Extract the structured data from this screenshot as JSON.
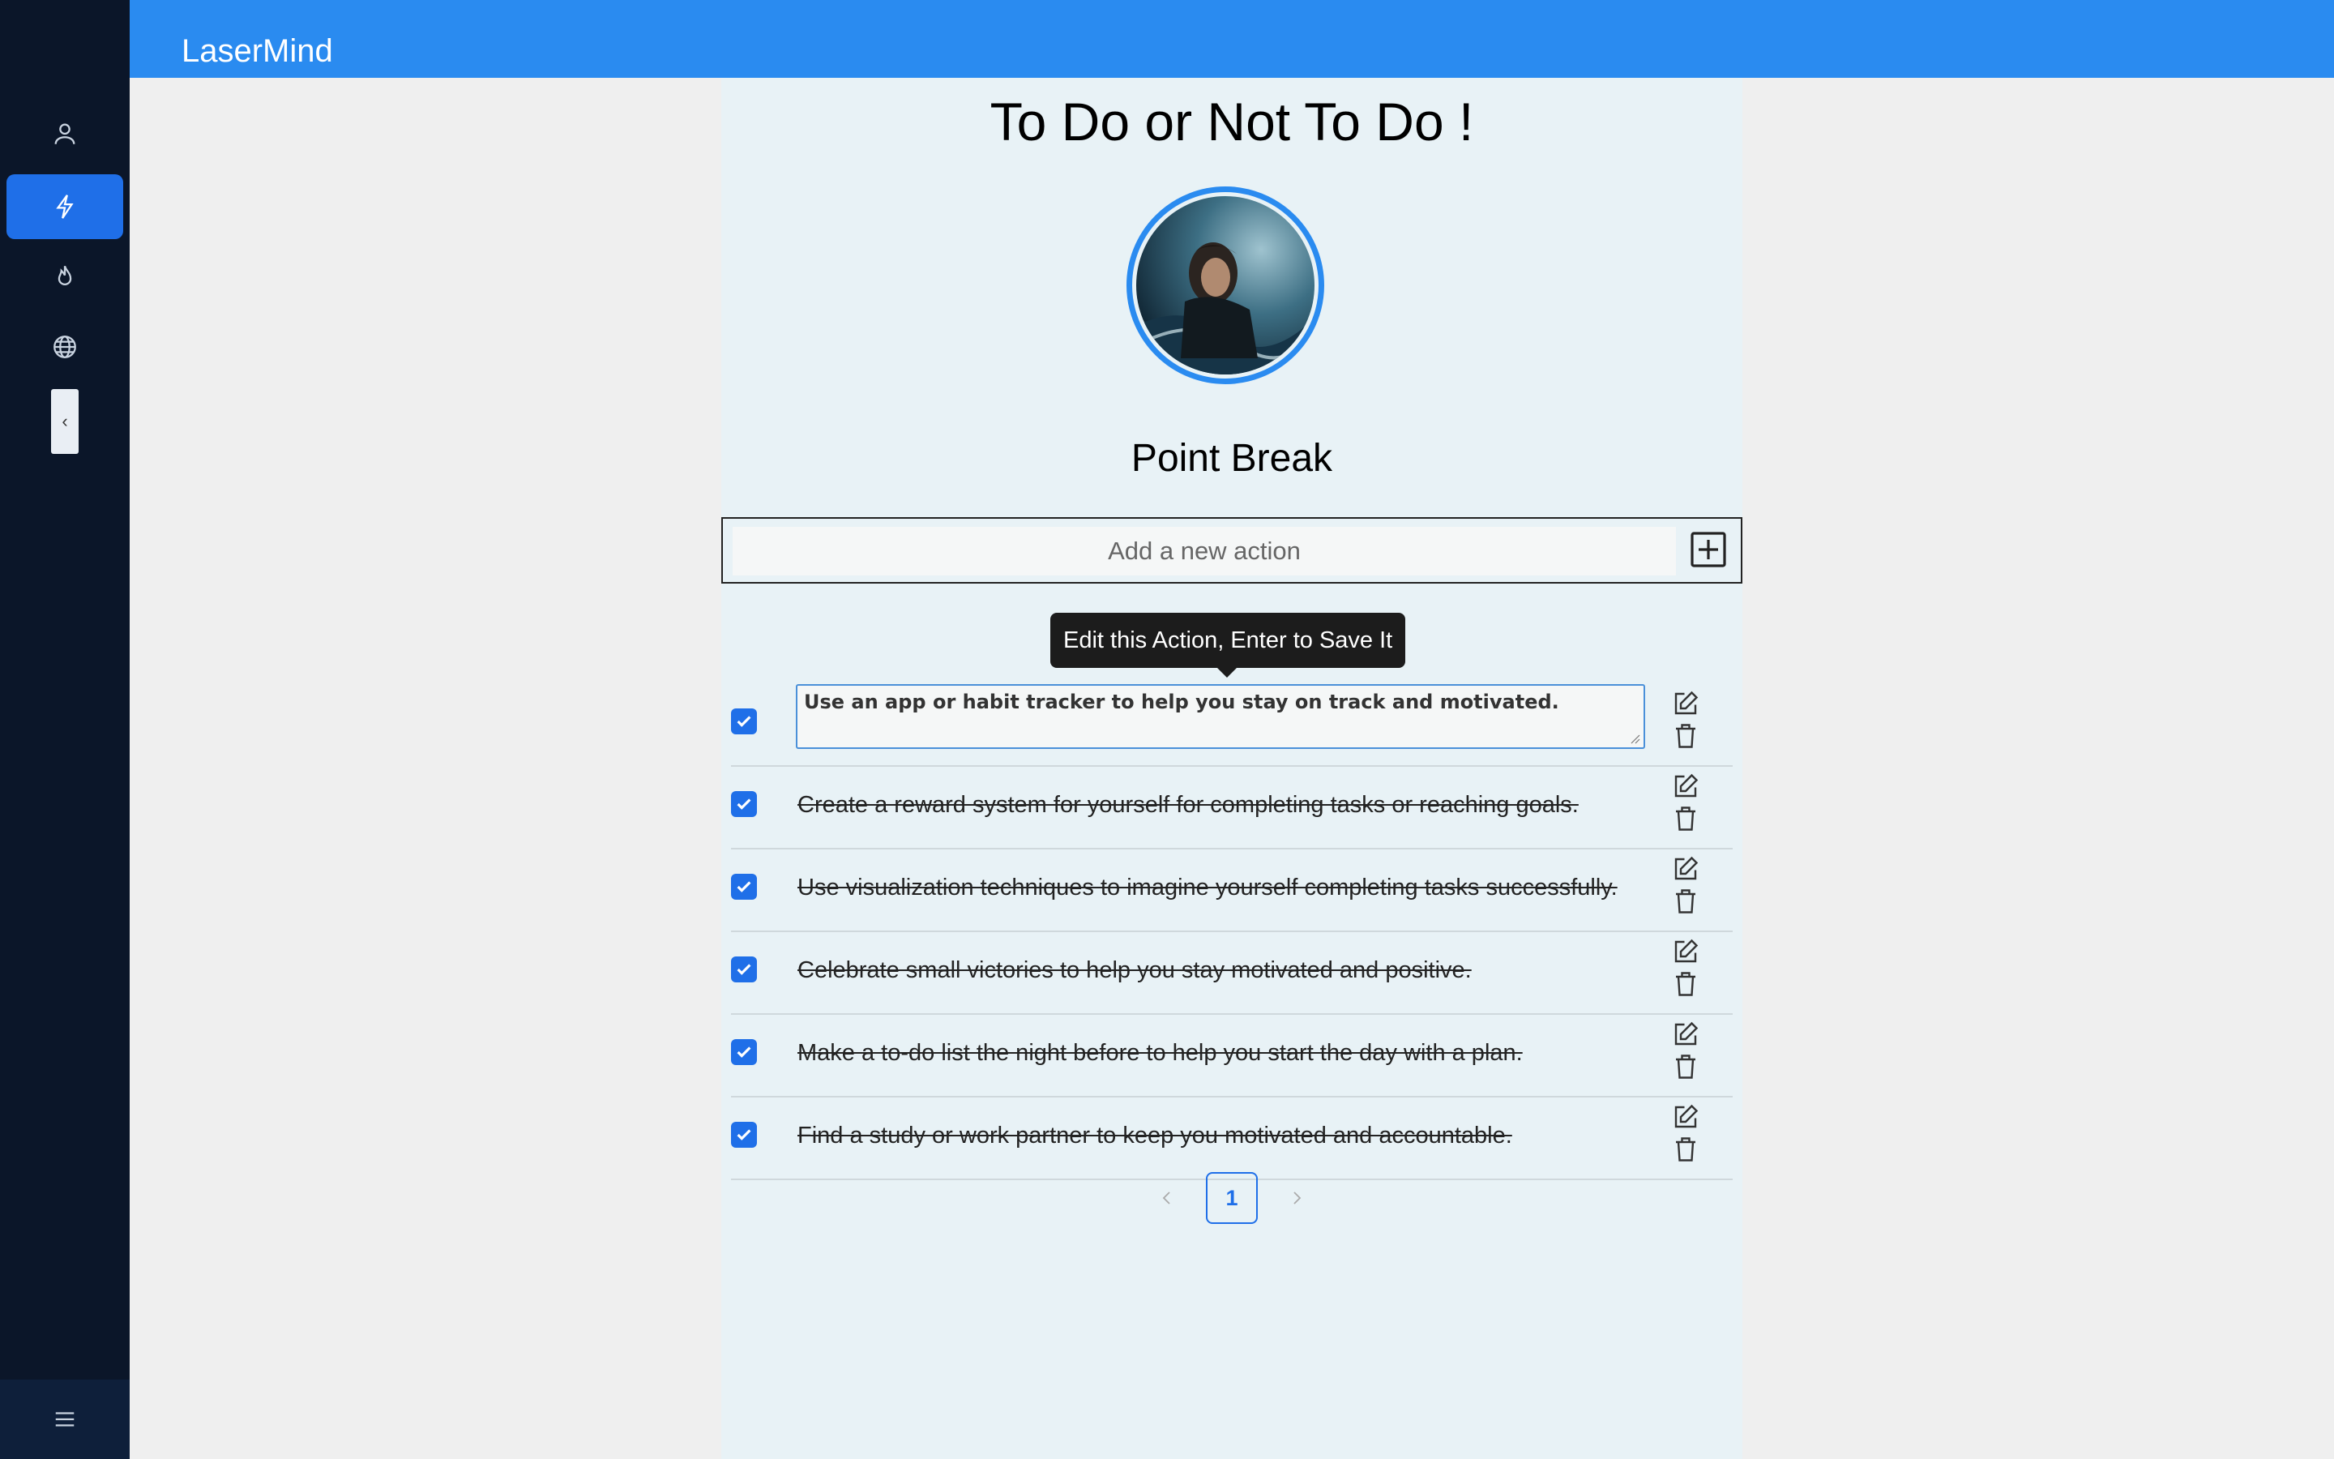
{
  "app": {
    "brand": "LaserMind"
  },
  "sidebar": {
    "items": [
      {
        "icon": "user-icon",
        "active": false
      },
      {
        "icon": "lightning-icon",
        "active": true
      },
      {
        "icon": "flame-icon",
        "active": false
      },
      {
        "icon": "globe-icon",
        "active": false
      }
    ],
    "collapse_glyph": "‹",
    "menu_icon": "hamburger-menu-icon"
  },
  "main": {
    "title": "To Do or Not To Do !",
    "profile_name": "Point Break",
    "add_action": {
      "placeholder": "Add a new action",
      "button_icon": "plus-square-icon"
    },
    "tooltip": "Edit this Action, Enter to Save It",
    "editing_item": {
      "text": "Use an app or habit tracker to help you stay on track and motivated.",
      "checked": true
    },
    "items": [
      {
        "text": "Create a reward system for yourself for completing tasks or reaching goals.",
        "checked": true
      },
      {
        "text": "Use visualization techniques to imagine yourself completing tasks successfully.",
        "checked": true
      },
      {
        "text": "Celebrate small victories to help you stay motivated and positive.",
        "checked": true
      },
      {
        "text": "Make a to-do list the night before to help you start the day with a plan.",
        "checked": true
      },
      {
        "text": "Find a study or work partner to keep you motivated and accountable.",
        "checked": true
      }
    ],
    "pagination": {
      "current_page": "1"
    }
  },
  "colors": {
    "sidebar_bg": "#0b1629",
    "topbar_bg": "#2a8bf0",
    "accent": "#1f6fe8",
    "panel_bg": "#e8f2f6"
  }
}
